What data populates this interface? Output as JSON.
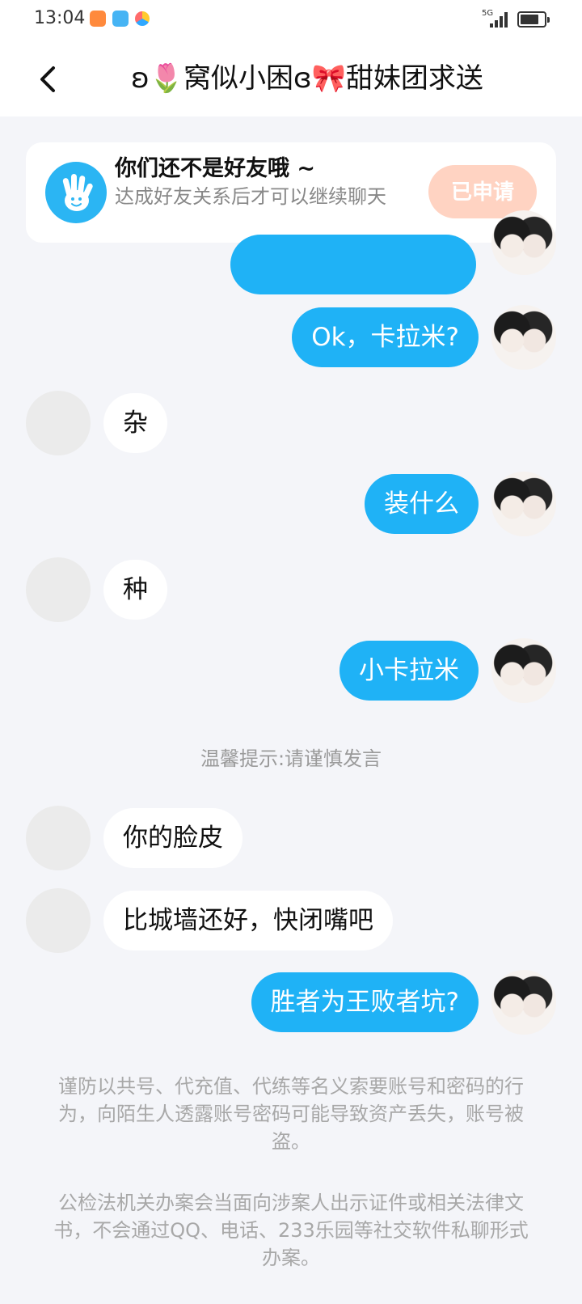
{
  "status_bar": {
    "time": "13:04",
    "network": "5G"
  },
  "header": {
    "title": "ʚ🌷窝似小困ɞ🎀甜妹团求送"
  },
  "notice": {
    "title": "你们还不是好友哦 ~",
    "subtitle": "达成好友关系后才可以继续聊天",
    "button": "已申请",
    "button_color": "#ffd3c2",
    "icon": "waving-hand-icon"
  },
  "messages": [
    {
      "from": "me",
      "text": "Ok，卡拉米?"
    },
    {
      "from": "them",
      "text": "杂"
    },
    {
      "from": "me",
      "text": "装什么"
    },
    {
      "from": "them",
      "text": "种"
    },
    {
      "from": "me",
      "text": "小卡拉米"
    },
    {
      "from": "system",
      "text": "温馨提示:请谨慎发言"
    },
    {
      "from": "them",
      "text": "你的脸皮"
    },
    {
      "from": "them",
      "text": "比城墙还好，快闭嘴吧"
    },
    {
      "from": "me",
      "text": "胜者为王败者坑?"
    }
  ],
  "warnings": [
    "谨防以共号、代充值、代练等名义索要账号和密码的行为，向陌生人透露账号密码可能导致资产丢失，账号被盗。",
    "公检法机关办案会当面向涉案人出示证件或相关法律文书，不会通过QQ、电话、233乐园等社交软件私聊形式办案。"
  ],
  "colors": {
    "my_bubble": "#1fb2f6",
    "their_bubble": "#ffffff",
    "background": "#f4f5f9"
  }
}
